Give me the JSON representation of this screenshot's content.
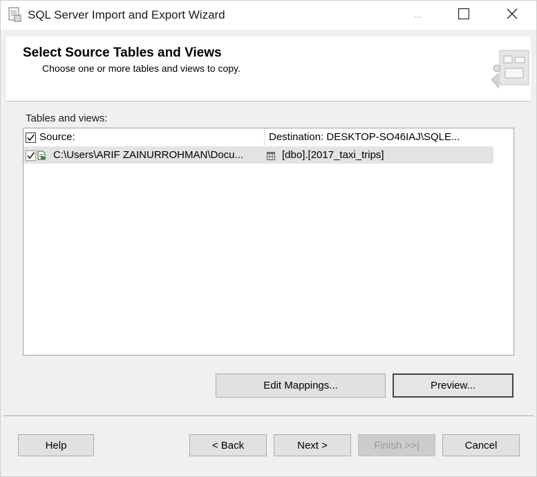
{
  "window": {
    "title": "SQL Server Import and Export Wizard"
  },
  "header": {
    "title": "Select Source Tables and Views",
    "subtitle": "Choose one or more tables and views to copy."
  },
  "tables": {
    "label": "Tables and views:",
    "columns": {
      "source": "Source:",
      "destination": "Destination: DESKTOP-SO46IAJ\\SQLE..."
    },
    "header_checked": true,
    "rows": [
      {
        "checked": true,
        "source": "C:\\Users\\ARIF ZAINURROHMAN\\Docu...",
        "destination": "[dbo].[2017_taxi_trips]"
      }
    ]
  },
  "buttons": {
    "edit_mappings": "Edit Mappings...",
    "preview": "Preview...",
    "help": "Help",
    "back": "< Back",
    "next": "Next >",
    "finish": "Finish >>|",
    "cancel": "Cancel"
  },
  "icons": {
    "app": "wizard-app-icon",
    "header": "wizard-header-graphic",
    "minimize": "minimize-icon",
    "maximize": "maximize-icon",
    "close": "close-icon",
    "source_file": "flat-file-icon",
    "destination_table": "table-icon"
  }
}
